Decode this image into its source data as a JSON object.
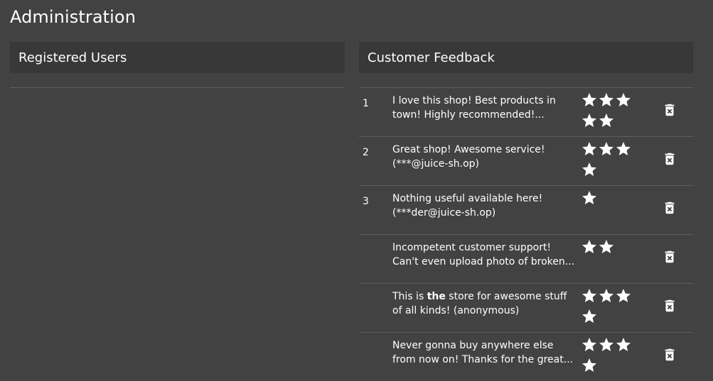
{
  "page": {
    "title": "Administration"
  },
  "users_panel": {
    "title": "Registered Users"
  },
  "feedback_panel": {
    "title": "Customer Feedback",
    "rows": [
      {
        "id": "1",
        "line1": "I love this shop! Best products in",
        "line2": "town! Highly recommended!...",
        "rating": 5
      },
      {
        "id": "2",
        "line1": "Great shop! Awesome service!",
        "line2": "(***@juice-sh.op)",
        "rating": 4
      },
      {
        "id": "3",
        "line1": "Nothing useful available here!",
        "line2": "(***der@juice-sh.op)",
        "rating": 1
      },
      {
        "id": "",
        "line1": "Incompetent customer support!",
        "line2": "Can't even upload photo of broken...",
        "rating": 2
      },
      {
        "id": "",
        "line1_pre": "This is ",
        "line1_bold": "the",
        "line1_post": " store for awesome stuff",
        "line2": "of all kinds! (anonymous)",
        "rating": 4
      },
      {
        "id": "",
        "line1": "Never gonna buy anywhere else",
        "line2": "from now on! Thanks for the great...",
        "rating": 4
      }
    ]
  },
  "colors": {
    "background": "#424242",
    "header": "#383838",
    "divider": "#5e5e5e",
    "text": "#ffffff"
  },
  "icons": {
    "star": "star-icon",
    "delete": "trash-icon"
  }
}
